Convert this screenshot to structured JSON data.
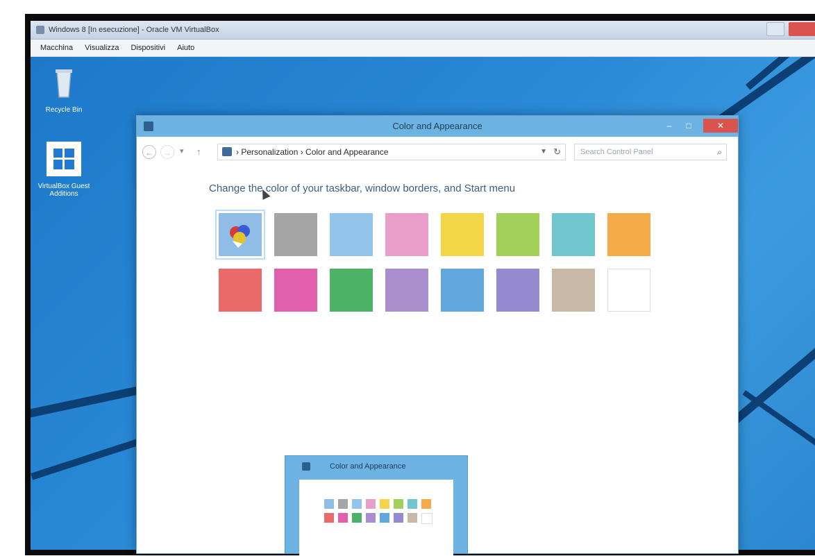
{
  "vm": {
    "title": "Windows 8 [In esecuzione] - Oracle VM VirtualBox",
    "menu": [
      "Macchina",
      "Visualizza",
      "Dispositivi",
      "Aiuto"
    ]
  },
  "desktop": {
    "icons": [
      {
        "label": "Recycle Bin",
        "icon": "recycle-bin-icon"
      },
      {
        "label": "VirtualBox Guest Additions",
        "icon": "windows-installer-icon"
      }
    ]
  },
  "window": {
    "title": "Color and Appearance",
    "address": {
      "crumbs": "›  Personalization  ›  Color and Appearance",
      "dropdown_icon": "chevron-down-icon",
      "refresh_icon": "refresh-icon"
    },
    "search": {
      "placeholder": "Search Control Panel",
      "icon": "magnifier-icon"
    },
    "heading": "Change the color of your taskbar, window borders, and Start menu",
    "swatches": [
      {
        "name": "automatic",
        "color": "#8fbde6",
        "selected": true
      },
      {
        "name": "gray",
        "color": "#a5a5a5"
      },
      {
        "name": "light-blue",
        "color": "#93c5ec"
      },
      {
        "name": "pink",
        "color": "#e89ec8"
      },
      {
        "name": "yellow",
        "color": "#f2d647"
      },
      {
        "name": "lime",
        "color": "#a3cf5b"
      },
      {
        "name": "teal",
        "color": "#72c6cf"
      },
      {
        "name": "orange",
        "color": "#f5ab4a"
      },
      {
        "name": "red",
        "color": "#ea6a6a"
      },
      {
        "name": "magenta",
        "color": "#e15fac"
      },
      {
        "name": "green",
        "color": "#4bb266"
      },
      {
        "name": "purple",
        "color": "#a98dcc"
      },
      {
        "name": "blue",
        "color": "#62a8de"
      },
      {
        "name": "violet",
        "color": "#958ad0"
      },
      {
        "name": "taupe",
        "color": "#c7b8a8"
      },
      {
        "name": "white",
        "color": "#ffffff"
      }
    ]
  },
  "thumbnail": {
    "title": "Color and Appearance"
  },
  "colors": {
    "accent": "#6cb3e4",
    "close": "#d9534f",
    "desktop": "#1d78c9"
  }
}
